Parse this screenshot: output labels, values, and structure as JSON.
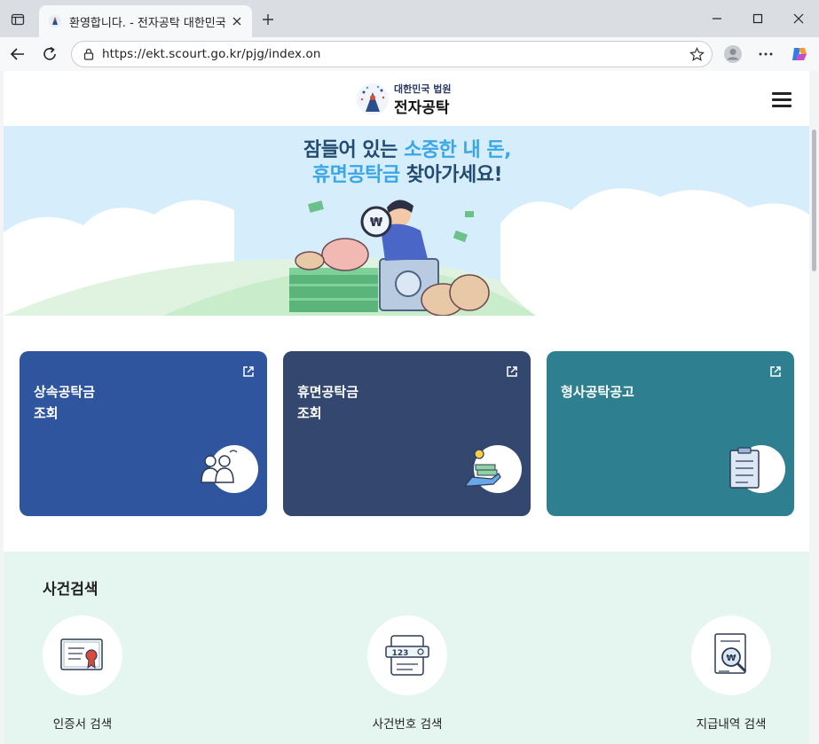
{
  "browser": {
    "tab_title": "환영합니다. - 전자공탁 대한민국",
    "url": "https://ekt.scourt.go.kr/pjg/index.on"
  },
  "site": {
    "logo_line1": "대한민국 법원",
    "logo_line2": "전자공탁"
  },
  "hero": {
    "line1_a": "잠들어 있는 ",
    "line1_b": "소중한 내 돈,",
    "line2_a": "휴면공탁금",
    "line2_b": " 찾아가세요!"
  },
  "cards": [
    {
      "line1": "상속공탁금",
      "line2": "조회",
      "color": "#2f559f"
    },
    {
      "line1": "휴면공탁금",
      "line2": "조회",
      "color": "#33476f"
    },
    {
      "line1": "형사공탁공고",
      "line2": "",
      "color": "#2e7f8f"
    }
  ],
  "case_search": {
    "title": "사건검색",
    "items": [
      {
        "label": "인증서 검색",
        "icon": "certificate-icon"
      },
      {
        "label": "사건번호 검색",
        "icon": "case-number-icon"
      },
      {
        "label": "지급내역 검색",
        "icon": "payment-history-icon"
      }
    ]
  }
}
